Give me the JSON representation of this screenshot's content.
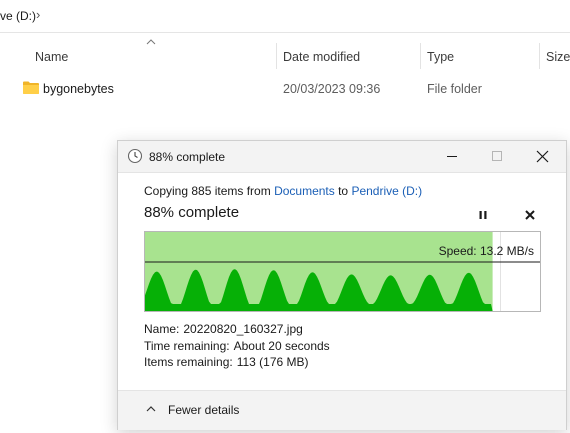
{
  "explorer": {
    "address_fragment": "ve (D:)",
    "columns": {
      "name": "Name",
      "date_modified": "Date modified",
      "type": "Type",
      "size": "Size"
    },
    "rows": [
      {
        "name": "bygonebytes",
        "date_modified": "20/03/2023 09:36",
        "type": "File folder"
      }
    ]
  },
  "dialog": {
    "title": "88% complete",
    "copy_prefix": "Copying 885 items from ",
    "source": "Documents",
    "copy_to": " to ",
    "destination": "Pendrive (D:)",
    "status": "88% complete",
    "progress_fraction": 0.88,
    "speed": "Speed: 13.2 MB/s",
    "name_label": "Name:",
    "name_value": "20220820_160327.jpg",
    "time_label": "Time remaining:",
    "time_value": "About 20 seconds",
    "items_label": "Items remaining:",
    "items_value": "113 (176 MB)",
    "fewer_details": "Fewer details"
  },
  "colors": {
    "progress_fill": "#a8e38f",
    "throughput_fill": "#06b006",
    "link": "#1b5fb6"
  }
}
